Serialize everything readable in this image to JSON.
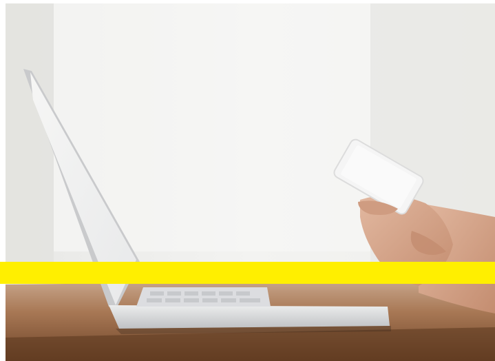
{
  "photo": {
    "subject": "laptop-and-smartphone",
    "colors": {
      "background": "#ecebe8",
      "window_light": "#f5f5f3",
      "laptop_body": "#d9dadc",
      "laptop_screen": "#f3f3f2",
      "phone": "#f4f4f4",
      "skin": "#d8a88f",
      "table": "#8a5a3a"
    }
  },
  "highlight_band": {
    "color": "#ffef00"
  }
}
